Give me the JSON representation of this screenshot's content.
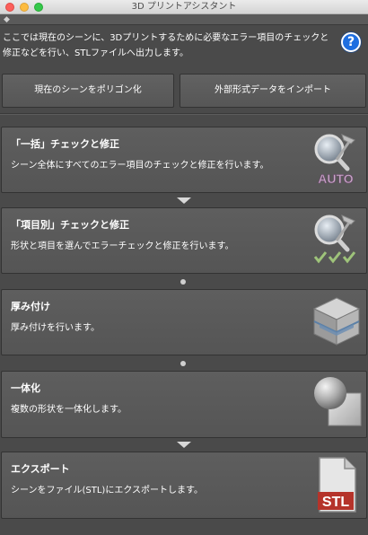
{
  "window": {
    "title": "3D プリントアシスタント"
  },
  "intro": {
    "text": "ここでは現在のシーンに、3Dプリントするために必要なエラー項目のチェックと修正などを行い、STLファイルへ出力します。",
    "help_label": "?"
  },
  "top_buttons": {
    "polygonize": "現在のシーンをポリゴン化",
    "import_external": "外部形式データをインポート"
  },
  "cards": [
    {
      "title": "「一括」チェックと修正",
      "desc": "シーン全体にすべてのエラー項目のチェックと修正を行います。",
      "icon_label": "AUTO"
    },
    {
      "title": "「項目別」チェックと修正",
      "desc": "形状と項目を選んでエラーチェックと修正を行います。"
    },
    {
      "title": "厚み付け",
      "desc": "厚み付けを行います。"
    },
    {
      "title": "一体化",
      "desc": "複数の形状を一体化します。"
    },
    {
      "title": "エクスポート",
      "desc": "シーンをファイル(STL)にエクスポートします。",
      "icon_label": "STL"
    }
  ],
  "colors": {
    "background": "#4a4a4a",
    "card": "#5a5a5a",
    "help_blue": "#1e6ee0",
    "stl_red": "#b5332a"
  }
}
